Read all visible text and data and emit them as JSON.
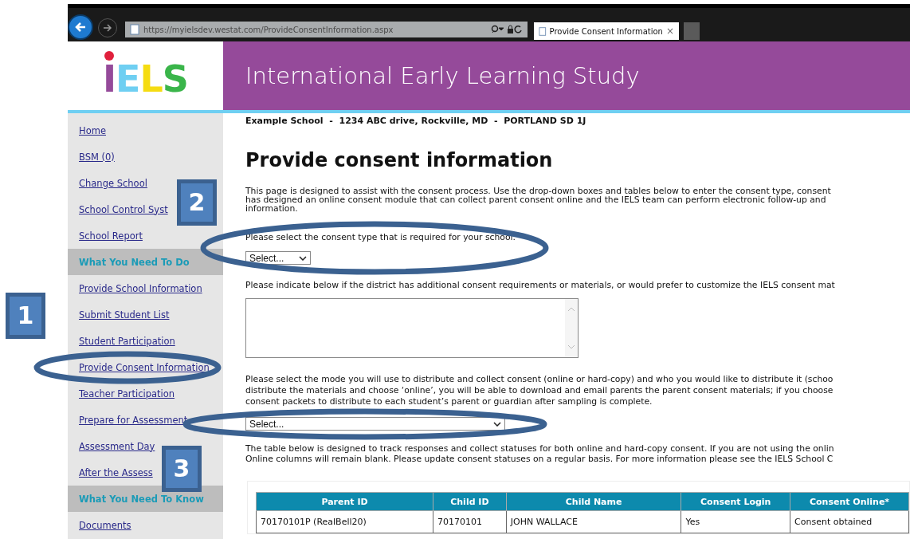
{
  "browser": {
    "url": "https://myielsdev.westat.com/ProvideConsentInformation.aspx",
    "tab_title": "Provide Consent Information",
    "tab_close": "×"
  },
  "header": {
    "logo": "IELS",
    "title": "International Early Learning Study"
  },
  "sidebar": {
    "items": [
      {
        "kind": "link",
        "label": "Home"
      },
      {
        "kind": "link",
        "label": "BSM (0)"
      },
      {
        "kind": "link",
        "label": "Change School"
      },
      {
        "kind": "link",
        "label": "School Control Syst"
      },
      {
        "kind": "link",
        "label": "School Report"
      },
      {
        "kind": "section",
        "label": "What You Need To Do"
      },
      {
        "kind": "link",
        "label": "Provide School Information"
      },
      {
        "kind": "link",
        "label": "Submit Student List"
      },
      {
        "kind": "link",
        "label": "Student Participation"
      },
      {
        "kind": "link",
        "label": "Provide Consent Information"
      },
      {
        "kind": "link",
        "label": "Teacher Participation"
      },
      {
        "kind": "link",
        "label": "Prepare for Assessment"
      },
      {
        "kind": "link",
        "label": "Assessment Day"
      },
      {
        "kind": "link",
        "label": "After the Assess"
      },
      {
        "kind": "section",
        "label": "What You Need To Know"
      },
      {
        "kind": "link",
        "label": "Documents"
      }
    ]
  },
  "content": {
    "school_line": "Example School  -  1234 ABC drive, Rockville, MD  -  PORTLAND SD 1J",
    "heading": "Provide consent information",
    "intro": [
      "This page is designed to assist with the consent process. Use the drop-down boxes and tables below to enter the consent type, consent",
      "has designed an online consent module that can collect parent consent online and the IELS team can perform electronic follow-up and",
      "information."
    ],
    "consent_type_label": "Please select the consent type that is required for your school.",
    "consent_type_select": "Select...",
    "requirements_label": "Please indicate below if the district has additional consent requirements or materials, or would prefer to customize the IELS consent mat",
    "mode_text": [
      "Please select the mode you will use to distribute and collect consent (online or hard-copy) and who you would like to distribute it (schoo",
      "distribute the materials and choose ‘online’, you will be able to download and email parents the parent consent materials; if you choose",
      "consent packets to distribute to each student’s parent or guardian after sampling is complete."
    ],
    "mode_select": "Select...",
    "table_text": [
      "The table below is designed to track responses and collect statuses for both online and hard-copy consent. If you are not using the onlin",
      "Online columns will remain blank. Please update consent statuses on a regular basis. For more information please see the IELS School C"
    ],
    "table": {
      "columns": [
        "Parent ID",
        "Child ID",
        "Child Name",
        "Consent Login",
        "Consent Online*"
      ],
      "rows": [
        [
          "70170101P (RealBell20)",
          "70170101",
          "JOHN WALLACE",
          "Yes",
          "Consent obtained"
        ]
      ]
    }
  },
  "annotations": [
    {
      "label": "1"
    },
    {
      "label": "2"
    },
    {
      "label": "3"
    }
  ]
}
